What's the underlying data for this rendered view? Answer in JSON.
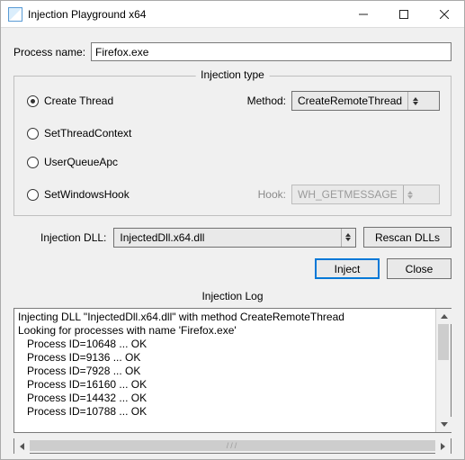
{
  "window": {
    "title": "Injection Playground x64"
  },
  "process_name": {
    "label": "Process name:",
    "value": "Firefox.exe"
  },
  "injection_type": {
    "legend": "Injection type",
    "radios": [
      {
        "label": "Create Thread",
        "checked": true
      },
      {
        "label": "SetThreadContext",
        "checked": false
      },
      {
        "label": "UserQueueApc",
        "checked": false
      },
      {
        "label": "SetWindowsHook",
        "checked": false
      }
    ],
    "method": {
      "label": "Method:",
      "value": "CreateRemoteThread"
    },
    "hook": {
      "label": "Hook:",
      "value": "WH_GETMESSAGE",
      "disabled": true
    }
  },
  "injection_dll": {
    "label": "Injection DLL:",
    "value": "InjectedDll.x64.dll"
  },
  "buttons": {
    "rescan": "Rescan DLLs",
    "inject": "Inject",
    "close": "Close"
  },
  "log": {
    "header": "Injection Log",
    "text": "Injecting DLL \"InjectedDll.x64.dll\" with method CreateRemoteThread\nLooking for processes with name 'Firefox.exe'\n   Process ID=10648 ... OK\n   Process ID=9136 ... OK\n   Process ID=7928 ... OK\n   Process ID=16160 ... OK\n   Process ID=14432 ... OK\n   Process ID=10788 ... OK"
  }
}
